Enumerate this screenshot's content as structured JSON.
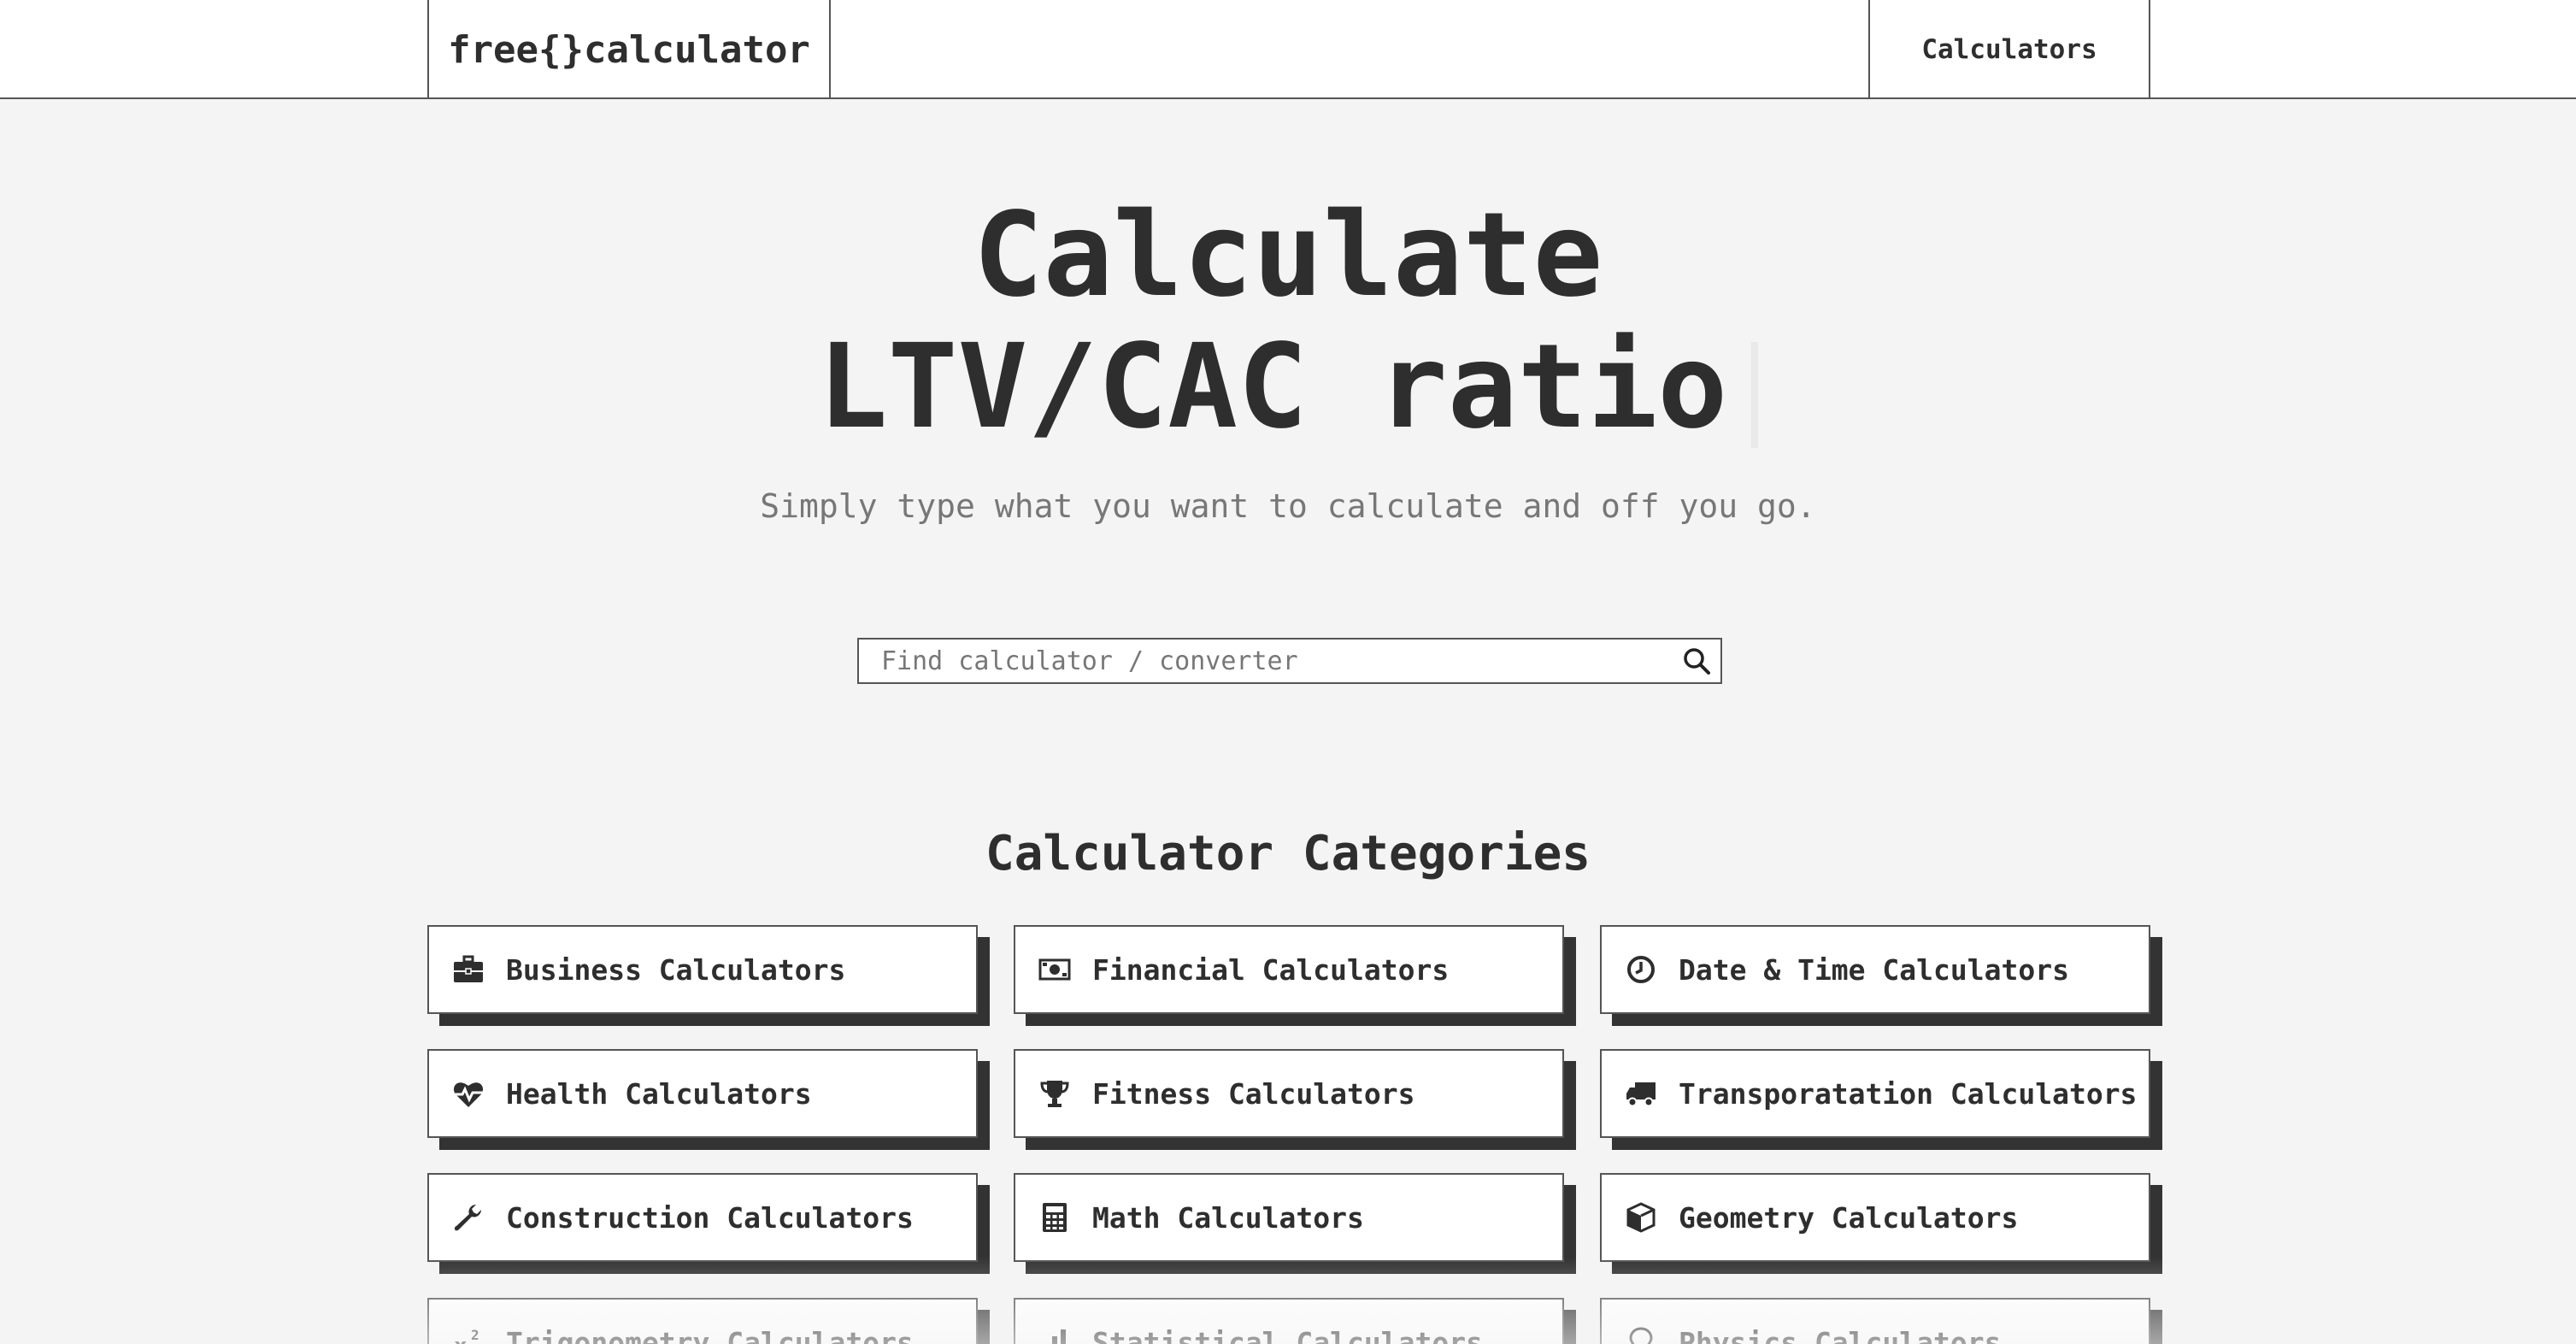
{
  "header": {
    "logo": "free{}calculator",
    "nav_calculators": "Calculators"
  },
  "hero": {
    "title_line1": "Calculate",
    "title_line2": "LTV/CAC ratio",
    "subtitle": "Simply type what you want to calculate and off you go."
  },
  "search": {
    "placeholder": "Find calculator / converter",
    "value": "",
    "icon": "search-icon"
  },
  "categories": {
    "title": "Calculator Categories",
    "items": [
      {
        "label": "Business Calculators",
        "icon": "briefcase-icon"
      },
      {
        "label": "Financial Calculators",
        "icon": "money-bill-icon"
      },
      {
        "label": "Date & Time Calculators",
        "icon": "clock-icon"
      },
      {
        "label": "Health Calculators",
        "icon": "heartbeat-icon"
      },
      {
        "label": "Fitness Calculators",
        "icon": "trophy-icon"
      },
      {
        "label": "Transporatation Calculators",
        "icon": "truck-icon"
      },
      {
        "label": "Construction Calculators",
        "icon": "wrench-icon"
      },
      {
        "label": "Math Calculators",
        "icon": "calculator-icon"
      },
      {
        "label": "Geometry Calculators",
        "icon": "cube-icon"
      },
      {
        "label": "Trigonometry Calculators",
        "icon": "superscript-icon"
      },
      {
        "label": "Statistical Calculators",
        "icon": "bar-chart-icon"
      },
      {
        "label": "Physics Calculators",
        "icon": "lightbulb-icon"
      }
    ]
  },
  "colors": {
    "background": "#f4f4f4",
    "text": "#2e2e2e",
    "muted": "#777777",
    "card_shadow": "#333333",
    "border": "#555555"
  }
}
